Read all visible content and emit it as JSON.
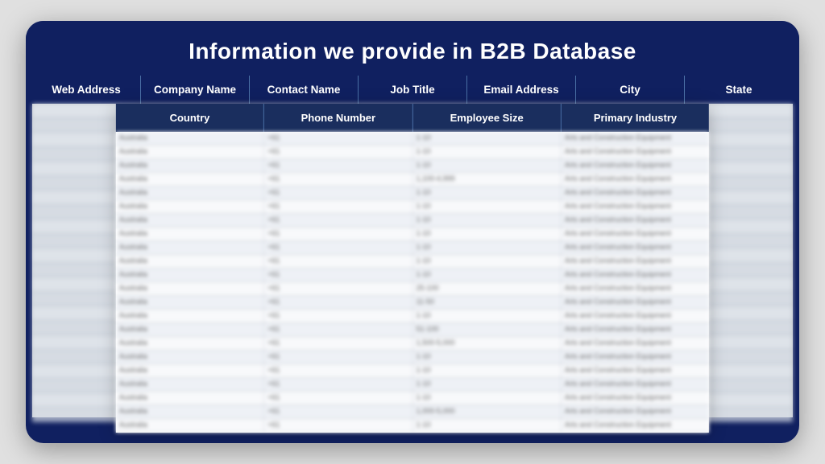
{
  "card": {
    "title": "Information we provide in B2B Database"
  },
  "top_header": {
    "columns": [
      "Web Address",
      "Company Name",
      "Contact Name",
      "Job Title",
      "Email Address",
      "City",
      "State"
    ]
  },
  "center_header": {
    "columns": [
      "Country",
      "Phone Number",
      "Employee Size",
      "Primary Industry"
    ]
  },
  "sample_rows": [
    [
      "Australia",
      "+61",
      "1-10",
      "Arts and Construction Equipment"
    ],
    [
      "Australia",
      "+61",
      "1-10",
      "Arts and Construction Equipment"
    ],
    [
      "Australia",
      "+61",
      "1-10",
      "Arts and Construction Equipment"
    ],
    [
      "Australia",
      "+61",
      "1,100-4,999",
      "Arts and Construction Equipment"
    ],
    [
      "Australia",
      "+61",
      "1-10",
      "Arts and Construction Equipment"
    ],
    [
      "Australia",
      "+61",
      "1-10",
      "Arts and Construction Equipment"
    ],
    [
      "Australia",
      "+61",
      "1-10",
      "Arts and Construction Equipment"
    ],
    [
      "Australia",
      "+61",
      "1-10",
      "Arts and Construction Equipment"
    ],
    [
      "Australia",
      "+61",
      "1-10",
      "Arts and Construction Equipment"
    ],
    [
      "Australia",
      "+61",
      "1-10",
      "Arts and Construction Equipment"
    ],
    [
      "Australia",
      "+61",
      "1-10",
      "Arts and Construction Equipment"
    ],
    [
      "Australia",
      "+61",
      "25-100",
      "Arts and Construction Equipment"
    ],
    [
      "Australia",
      "+61",
      "11-50",
      "Arts and Construction Equipment"
    ],
    [
      "Australia",
      "+61",
      "1-10",
      "Arts and Construction Equipment"
    ],
    [
      "Australia",
      "+61",
      "51-100",
      "Arts and Construction Equipment"
    ],
    [
      "Australia",
      "+61",
      "1,500-5,000",
      "Arts and Construction Equipment"
    ],
    [
      "Australia",
      "+61",
      "1-10",
      "Arts and Construction Equipment"
    ],
    [
      "Australia",
      "+61",
      "1-10",
      "Arts and Construction Equipment"
    ],
    [
      "Australia",
      "+61",
      "1-10",
      "Arts and Construction Equipment"
    ],
    [
      "Australia",
      "+61",
      "1-10",
      "Arts and Construction Equipment"
    ],
    [
      "Australia",
      "+61",
      "1,000-5,000",
      "Arts and Construction Equipment"
    ],
    [
      "Australia",
      "+61",
      "1-10",
      "Arts and Construction Equipment"
    ]
  ]
}
